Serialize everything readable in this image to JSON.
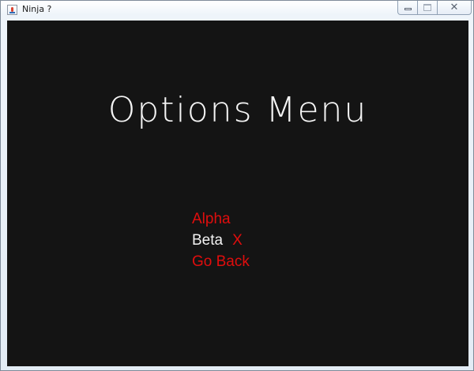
{
  "window": {
    "title": "Ninja ?",
    "close_glyph": "✕"
  },
  "game": {
    "menu_title": "Options Menu",
    "options": [
      {
        "label": "Alpha",
        "color": "#e00d0d"
      },
      {
        "label": "Beta",
        "color": "#f2f2f2",
        "marker": "X"
      },
      {
        "label": "Go Back",
        "color": "#e00d0d"
      }
    ],
    "background_color": "#141414"
  }
}
